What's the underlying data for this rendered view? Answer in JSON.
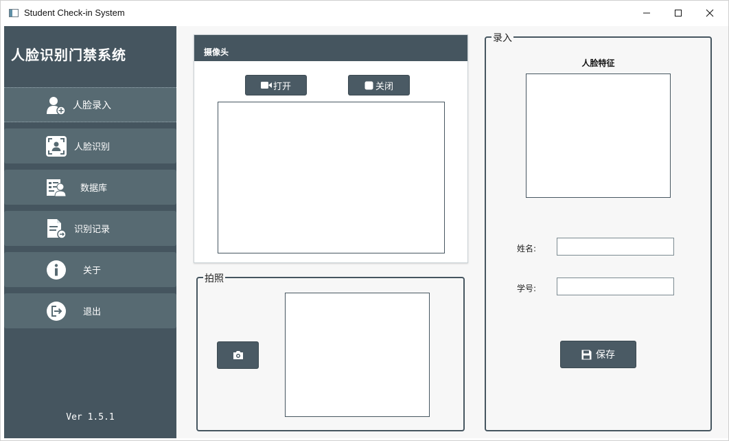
{
  "window": {
    "title": "Student Check-in System",
    "controls": {
      "minimize": "minimize-icon",
      "maximize": "maximize-icon",
      "close": "close-icon"
    }
  },
  "sidebar": {
    "title": "人脸识别门禁系统",
    "items": [
      {
        "label": "人脸录入",
        "icon": "user-add-icon",
        "active": true
      },
      {
        "label": "人脸识别",
        "icon": "face-scan-icon",
        "active": false
      },
      {
        "label": "数据库",
        "icon": "database-card-icon",
        "active": false
      },
      {
        "label": "识别记录",
        "icon": "record-file-icon",
        "active": false
      },
      {
        "label": "关于",
        "icon": "info-icon",
        "active": false
      },
      {
        "label": "退出",
        "icon": "exit-icon",
        "active": false
      }
    ],
    "version": "Ver 1.5.1"
  },
  "camera": {
    "header": "摄像头",
    "open_label": "打开",
    "close_label": "关闭"
  },
  "photo": {
    "group_title": "拍照",
    "capture_icon": "camera-icon"
  },
  "entry": {
    "group_title": "录入",
    "feature_label": "人脸特征",
    "name_label": "姓名:",
    "name_value": "",
    "id_label": "学号:",
    "id_value": "",
    "save_label": "保存"
  },
  "colors": {
    "sidebar_bg": "#45555f",
    "nav_item_bg": "#576a72",
    "accent_dark": "#45555f"
  }
}
